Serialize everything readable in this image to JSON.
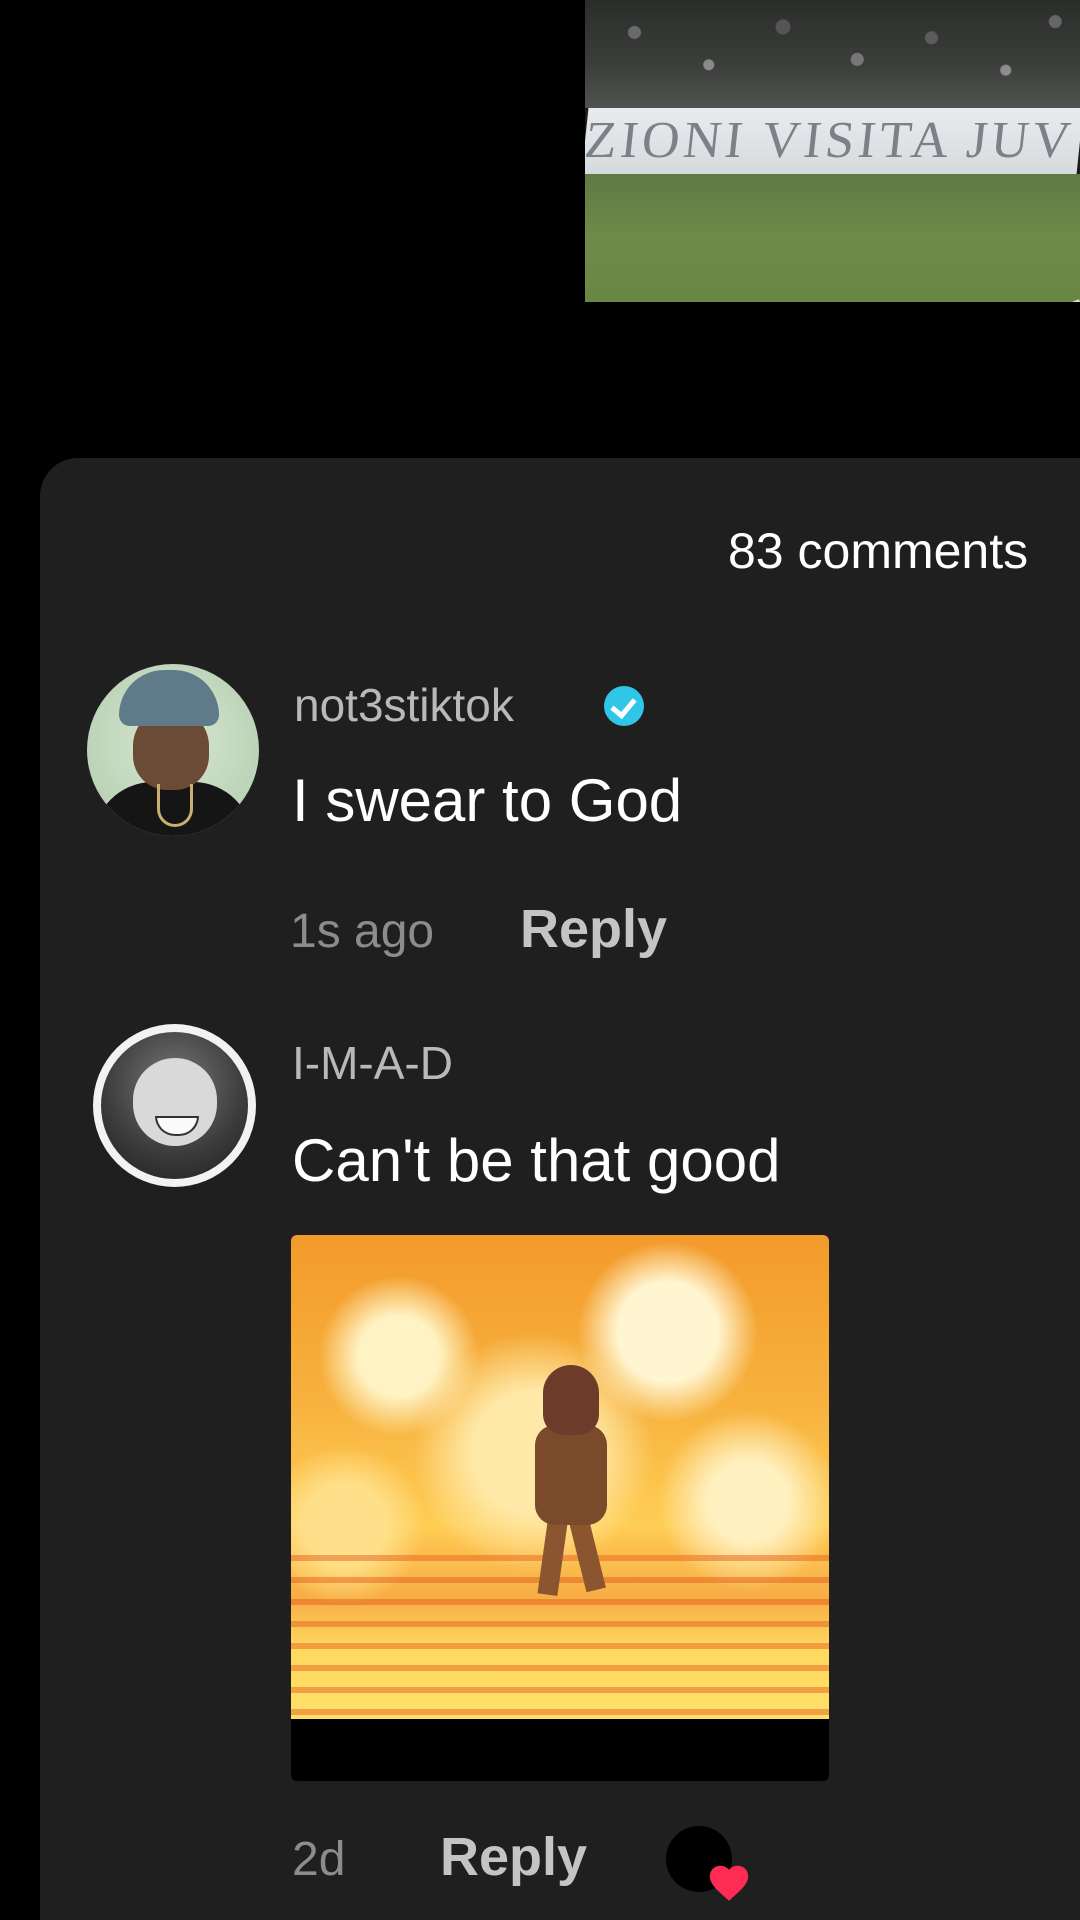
{
  "video": {
    "board_text": "ZIONI VISITA JUV"
  },
  "comments_header": {
    "count_label": "83 comments"
  },
  "comments": [
    {
      "username": "not3stiktok",
      "verified": true,
      "text": "I swear to God",
      "time": "1s ago",
      "reply_label": "Reply"
    },
    {
      "username": "I-M-A-D",
      "verified": false,
      "text": "Can't be that good",
      "attachment": "gif",
      "time": "2d",
      "reply_label": "Reply",
      "liked_by_creator": true
    }
  ],
  "colors": {
    "sheet_bg": "#1f1f1f",
    "verified": "#2fc6e8",
    "heart": "#fe2c55"
  }
}
